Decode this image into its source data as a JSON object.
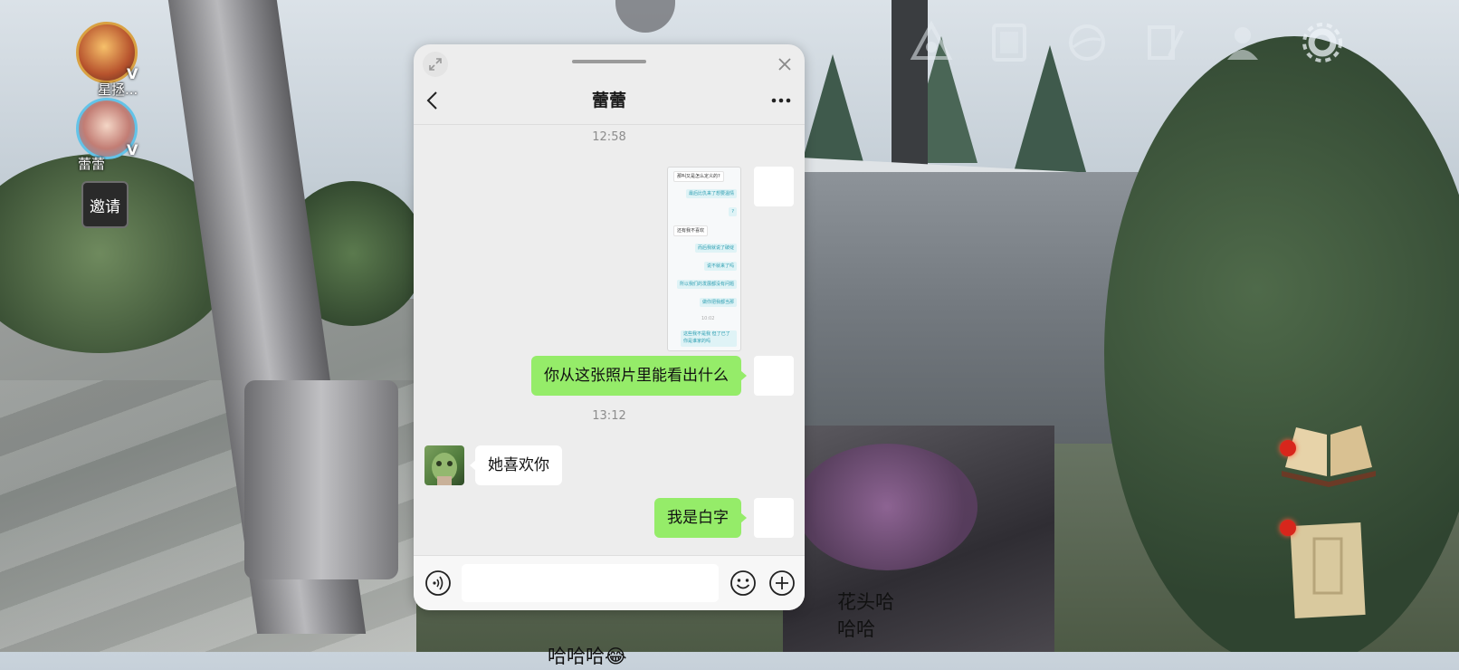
{
  "hud": {
    "player1": {
      "name": "星拯...",
      "badge": "V"
    },
    "player2": {
      "name": "蕾蕾",
      "badge": "V"
    },
    "invite_label": "邀请",
    "top_icons": [
      "triangle-emblem-icon",
      "codex-icon",
      "globe-icon",
      "notes-icon",
      "friends-icon",
      "settings-gear-icon"
    ],
    "right_items": [
      "book-icon",
      "map-icon"
    ]
  },
  "chat": {
    "title": "蕾蕾",
    "messages": [
      {
        "type": "timestamp",
        "text": "12:58"
      },
      {
        "type": "image",
        "sender": "self",
        "image_lines": [
          {
            "side": "l",
            "text": "那叫又是怎么定义的?"
          },
          {
            "side": "r",
            "text": "最后比仇来了想要温情"
          },
          {
            "side": "r",
            "text": "?"
          },
          {
            "side": "l",
            "text": "还有我不喜欢"
          },
          {
            "side": "r",
            "text": "而后我就说了破绽"
          },
          {
            "side": "r",
            "text": "说不就来了吗"
          },
          {
            "side": "r",
            "text": "所以我们的发展都没有问题"
          },
          {
            "side": "r",
            "text": "做你把我都当那"
          },
          {
            "side": "c",
            "text": "10:02"
          },
          {
            "side": "r",
            "text": "这些我不是我 但了已了你是谁家的吗"
          }
        ]
      },
      {
        "type": "text",
        "sender": "self",
        "text": "你从这张照片里能看出什么"
      },
      {
        "type": "timestamp",
        "text": "13:12"
      },
      {
        "type": "text",
        "sender": "other",
        "text": "她喜欢你"
      },
      {
        "type": "text",
        "sender": "self",
        "text": "我是白字"
      }
    ],
    "input": {
      "value": "",
      "placeholder": ""
    }
  },
  "overlay_caption": {
    "line1": "花头哈哈哈",
    "line2": "哈哈哈😂"
  }
}
